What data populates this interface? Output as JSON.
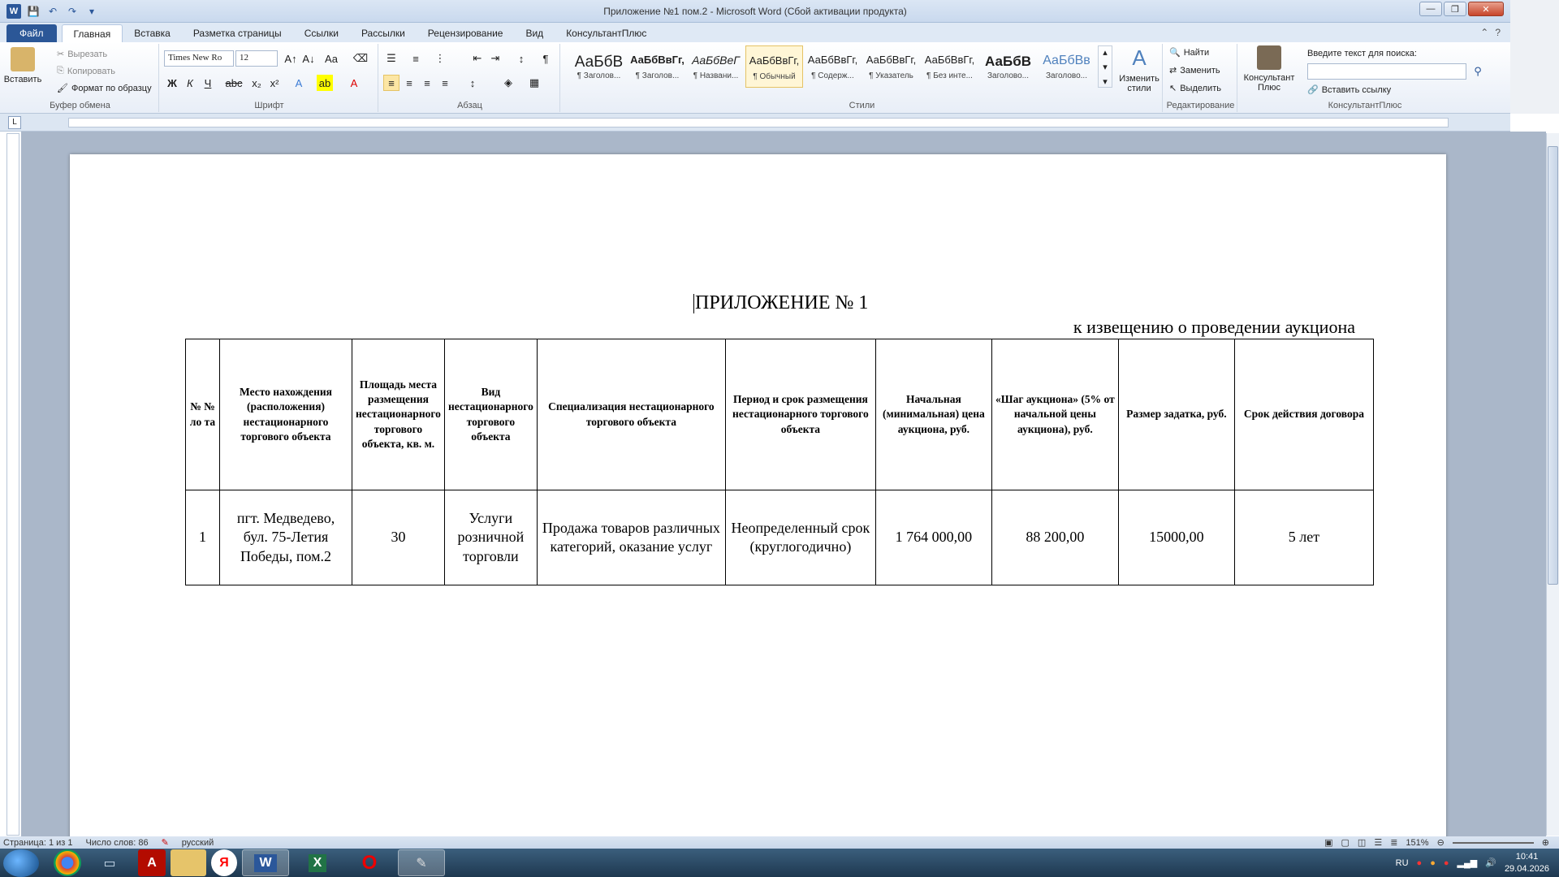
{
  "window": {
    "title": "Приложение №1 пом.2 - Microsoft Word (Сбой активации продукта)"
  },
  "tabs": [
    "Файл",
    "Главная",
    "Вставка",
    "Разметка страницы",
    "Ссылки",
    "Рассылки",
    "Рецензирование",
    "Вид",
    "КонсультантПлюс"
  ],
  "ribbon": {
    "clipboard": {
      "paste": "Вставить",
      "cut": "Вырезать",
      "copy": "Копировать",
      "format_painter": "Формат по образцу",
      "label": "Буфер обмена"
    },
    "font": {
      "family": "Times New Ro",
      "size": "12",
      "label": "Шрифт",
      "bold": "Ж",
      "italic": "К",
      "underline": "Ч"
    },
    "paragraph": {
      "label": "Абзац"
    },
    "styles": {
      "label": "Стили",
      "items": [
        {
          "sample": "АаБбВ",
          "name": "¶ Заголов..."
        },
        {
          "sample": "АаБбВвГг,",
          "name": "¶ Заголов..."
        },
        {
          "sample": "АаБбВеГ",
          "name": "¶ Названи..."
        },
        {
          "sample": "АаБбВвГг,",
          "name": "¶ Обычный"
        },
        {
          "sample": "АаБбВвГг,",
          "name": "¶ Содерж..."
        },
        {
          "sample": "АаБбВвГг,",
          "name": "¶ Указатель"
        },
        {
          "sample": "АаБбВвГг,",
          "name": "¶ Без инте..."
        },
        {
          "sample": "АаБбВ",
          "name": "Заголово..."
        },
        {
          "sample": "АаБбВв",
          "name": "Заголово..."
        }
      ],
      "change_styles": "Изменить стили"
    },
    "editing": {
      "find": "Найти",
      "replace": "Заменить",
      "select": "Выделить",
      "label": "Редактирование"
    },
    "consultant": {
      "button": "Консультант Плюс",
      "search_label": "Введите текст для поиска:",
      "insert_link": "Вставить ссылку",
      "label": "КонсультантПлюс"
    }
  },
  "document": {
    "heading1": "ПРИЛОЖЕНИЕ № 1",
    "heading2": "к извещению о проведении аукциона",
    "table": {
      "headers": [
        "№ № ло та",
        "Место нахождения (расположения) нестационарного торгового объекта",
        "Площадь места размещения нестационарного торгового объекта, кв. м.",
        "Вид нестационарного торгового объекта",
        "Специализация нестационарного торгового объекта",
        "Период и срок размещения нестационарного торгового объекта",
        "Начальная (минимальная) цена аукциона, руб.",
        "«Шаг аукциона» (5% от начальной цены аукциона), руб.",
        "Размер задатка, руб.",
        "Срок действия договора"
      ],
      "rows": [
        [
          "1",
          "пгт. Медведево, бул. 75-Летия Победы, пом.2",
          "30",
          "Услуги розничной торговли",
          "Продажа товаров различных категорий, оказание услуг",
          "Неопределенный срок (круглогодично)",
          "1 764 000,00",
          "88 200,00",
          "15000,00",
          "5 лет"
        ]
      ]
    }
  },
  "statusbar": {
    "page": "Страница: 1 из 1",
    "words": "Число слов: 86",
    "language": "русский",
    "zoom": "151%"
  },
  "taskbar": {
    "lang": "RU",
    "time": "10:41",
    "date": "29.04.2026"
  }
}
